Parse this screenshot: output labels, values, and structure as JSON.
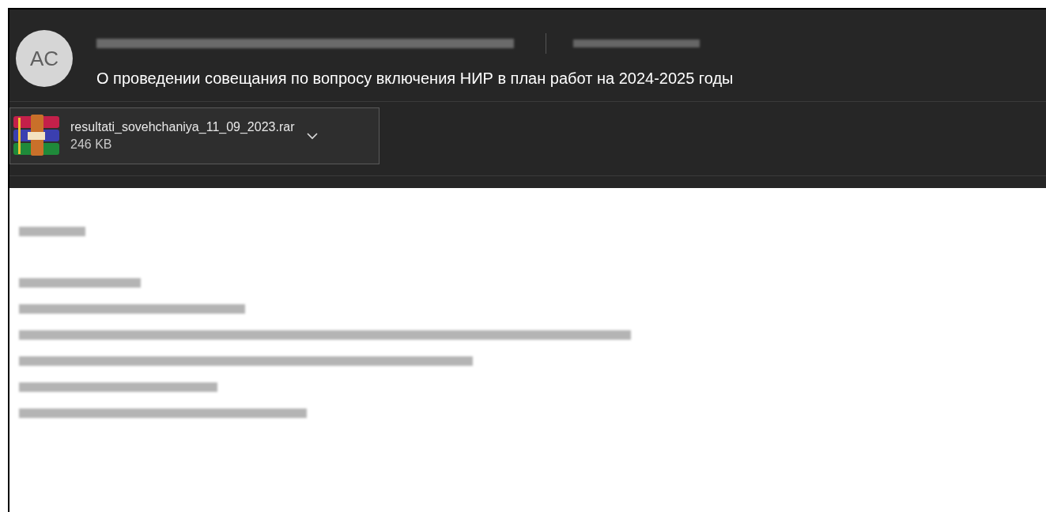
{
  "message": {
    "avatar_initials": "AC",
    "subject": "О проведении совещания по вопросу включения НИР в план работ на 2024-2025 годы"
  },
  "attachment": {
    "name": "resultati_sovehchaniya_11_09_2023.rar",
    "size": "246 KB"
  }
}
